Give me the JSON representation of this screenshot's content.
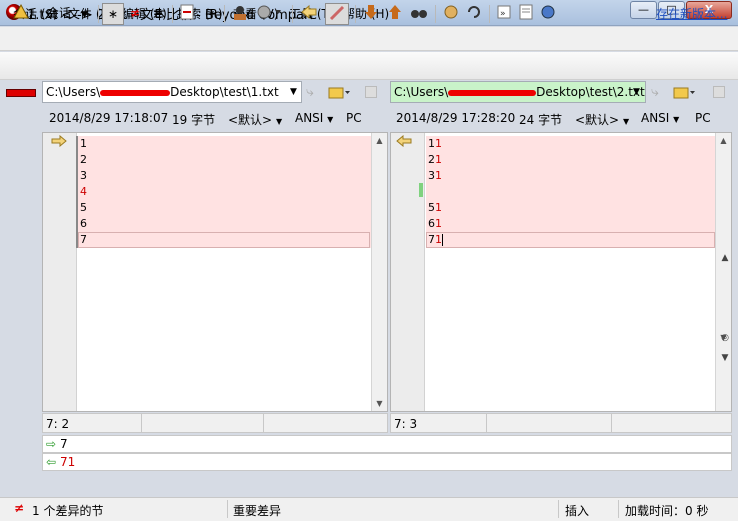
{
  "window": {
    "title": "1.txt <--> 2.txt - 文本比较 - Beyond Compare",
    "min": "—",
    "max": "□",
    "close": "X"
  },
  "menu": {
    "items": [
      "会话 (S)",
      "文件 (F)",
      "编辑 (E)",
      "搜索 (R)",
      "查看 (V)",
      "工具 (T)",
      "帮助 (H)"
    ],
    "new_version": "存在新版本..."
  },
  "toolbar": {
    "session_label": "会话",
    "all": "∗",
    "diff": "≠",
    "same": "=",
    "approx": "≈"
  },
  "left": {
    "path_visible": "C:\\Users\\",
    "path_tail": "Desktop\\test\\1.txt",
    "date": "2014/8/29 17:18:07",
    "size": "19 字节",
    "encoding_default": "<默认>",
    "ansi": "ANSI",
    "pc": "PC",
    "lines": [
      "1",
      "2",
      "3",
      "4",
      "5",
      "6",
      "7"
    ],
    "cursor": "7: 2"
  },
  "right": {
    "path_visible": "C:\\Users\\",
    "path_tail": "Desktop\\test\\2.txt",
    "date": "2014/8/29 17:28:20",
    "size": "24 字节",
    "encoding_default": "<默认>",
    "ansi": "ANSI",
    "pc": "PC",
    "lines": [
      "11",
      "21",
      "31",
      "",
      "51",
      "61",
      "71"
    ],
    "cursor": "7: 3"
  },
  "compare": {
    "line_left": "7",
    "line_right": "71"
  },
  "statusbar": {
    "diff_count": "1 个差异的节",
    "important": "重要差异",
    "mode": "插入",
    "load_time": "加载时间：0 秒"
  },
  "colors": {
    "diff_bg": "#ffe2e2",
    "diff_text": "#cc0000",
    "right_path_bg": "#c9f3c9"
  }
}
